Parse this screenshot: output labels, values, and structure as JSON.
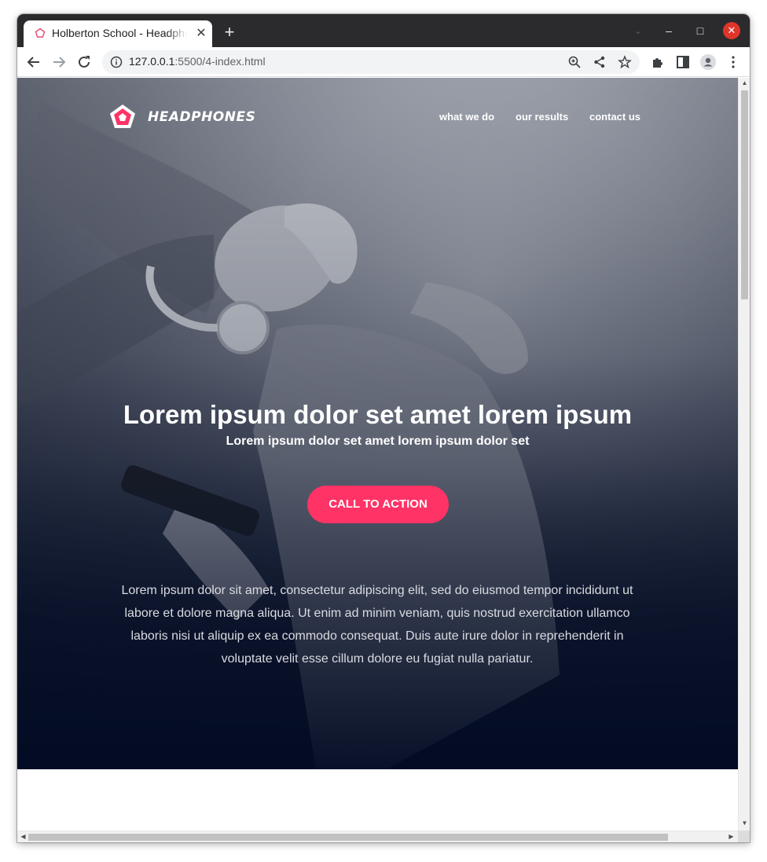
{
  "browser": {
    "tab_title": "Holberton School - Headphones",
    "tab_close": "✕",
    "new_tab": "+",
    "url_host": "127.0.0.1",
    "url_path": ":5500/4-index.html",
    "window_controls": {
      "minimize": "–",
      "maximize": "□",
      "close": "✕"
    },
    "icons": [
      "back-arrow-icon",
      "forward-arrow-icon",
      "reload-icon",
      "info-icon",
      "zoom-icon",
      "share-icon",
      "star-icon",
      "extensions-icon",
      "side-panel-icon",
      "profile-icon",
      "menu-icon"
    ]
  },
  "header": {
    "brand": "HEADPHONES",
    "nav": [
      "what we do",
      "our results",
      "contact us"
    ]
  },
  "hero": {
    "title": "Lorem ipsum dolor set amet lorem ipsum",
    "subtitle": "Lorem ipsum dolor set amet lorem ipsum dolor set",
    "cta": "CALL TO ACTION",
    "text": "Lorem ipsum dolor sit amet, consectetur adipiscing elit, sed do eiusmod tempor incididunt ut labore et dolore magna aliqua. Ut enim ad minim veniam, quis nostrud exercitation ullamco laboris nisi ut aliquip ex ea commodo consequat. Duis aute irure dolor in reprehenderit in voluptate velit esse cillum dolore eu fugiat nulla pariatur."
  },
  "colors": {
    "accent": "#ff3366",
    "hero_dark": "#030c24",
    "titlebar": "#2b2b2d"
  }
}
